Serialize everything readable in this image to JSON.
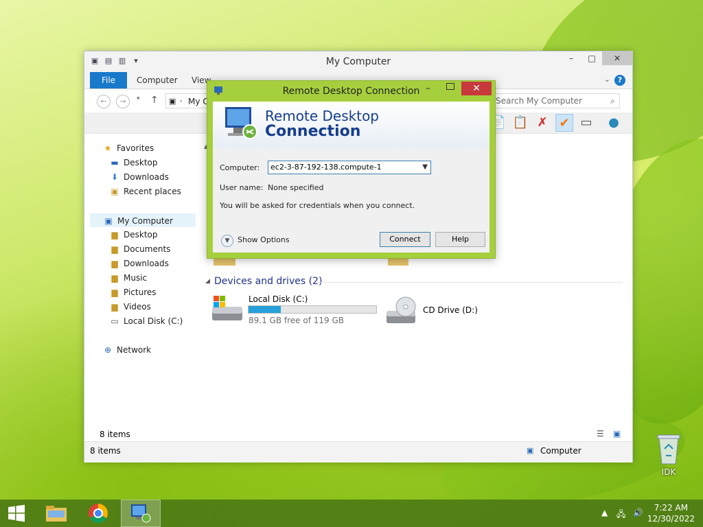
{
  "explorer": {
    "title": "My Computer",
    "ribbon": {
      "file": "File",
      "computer": "Computer",
      "view": "View"
    },
    "address": "My C",
    "search_placeholder": "Search My Computer",
    "nav": {
      "favorites": "Favorites",
      "fav_desktop": "Desktop",
      "fav_downloads": "Downloads",
      "fav_recent": "Recent places",
      "my_computer": "My Computer",
      "pc_desktop": "Desktop",
      "pc_documents": "Documents",
      "pc_downloads": "Downloads",
      "pc_music": "Music",
      "pc_pictures": "Pictures",
      "pc_videos": "Videos",
      "pc_local_disk": "Local Disk (C:)",
      "network": "Network"
    },
    "group_devices": "Devices and drives (2)",
    "drives": [
      {
        "name": "Local Disk (C:)",
        "free": "89.1 GB free of 119 GB",
        "used_fraction": 0.25
      },
      {
        "name": "CD Drive (D:)"
      }
    ],
    "items_count_inner": "8 items",
    "status_items": "8 items",
    "status_location": "Computer"
  },
  "rdc": {
    "title": "Remote Desktop Connection",
    "banner_line1": "Remote Desktop",
    "banner_line2": "Connection",
    "computer_label": "Computer:",
    "computer_value": "ec2-3-87-192-138.compute-1",
    "username_label": "User name:",
    "username_value": "None specified",
    "note": "You will be asked for credentials when you connect.",
    "show_options": "Show Options",
    "connect": "Connect",
    "help": "Help"
  },
  "desktop": {
    "recycle_label": "IDK"
  },
  "taskbar": {
    "time": "7:22 AM",
    "date": "12/30/2022"
  },
  "colors": {
    "ribbon_file": "#1979ca",
    "rdc_frame": "#a6cf3e",
    "close_red": "#c7393a",
    "progress": "#26a0da"
  }
}
